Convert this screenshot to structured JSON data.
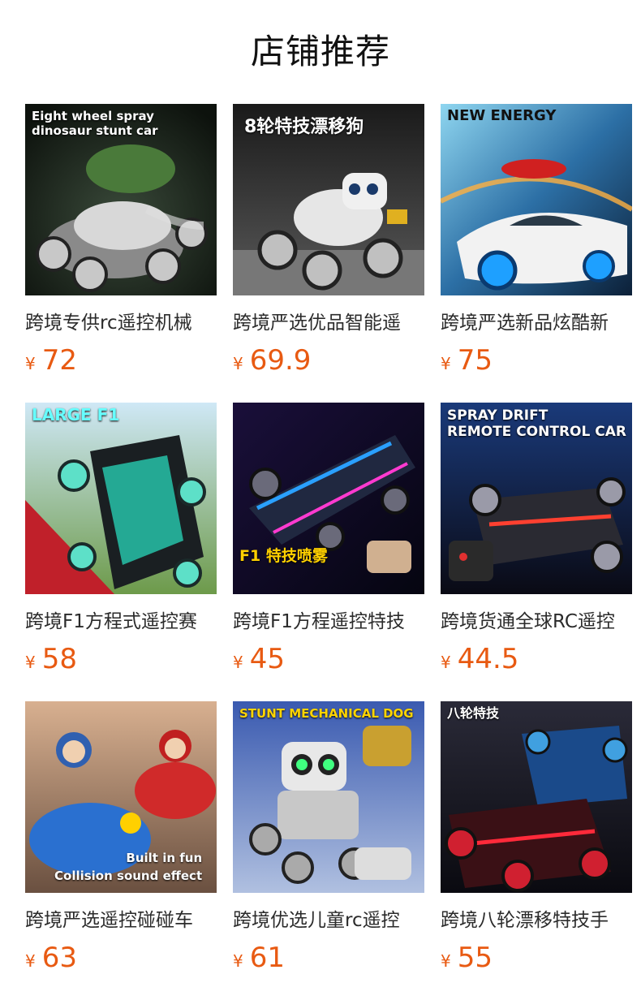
{
  "header": {
    "title": "店铺推荐"
  },
  "products": [
    {
      "title": "跨境专供rc遥控机械",
      "currency": "¥",
      "price": "72",
      "image_text": "Eight wheel spray\ndinosaur stunt car",
      "image_subject": "dinosaur-stunt-car"
    },
    {
      "title": "跨境严选优品智能遥",
      "currency": "¥",
      "price": "69.9",
      "image_text": "8轮特技漂移狗",
      "image_subject": "stunt-robot-dog"
    },
    {
      "title": "跨境严选新品炫酷新",
      "currency": "¥",
      "price": "75",
      "image_text": "NEW ENERGY",
      "image_subject": "concept-rc-car"
    },
    {
      "title": "跨境F1方程式遥控赛",
      "currency": "¥",
      "price": "58",
      "image_text": "LARGE F1",
      "image_subject": "f1-race-car-teal"
    },
    {
      "title": "跨境F1方程遥控特技",
      "currency": "¥",
      "price": "45",
      "image_text": "F1 特技喷雾",
      "image_subject": "f1-spray-stunt-car"
    },
    {
      "title": "跨境货通全球RC遥控",
      "currency": "¥",
      "price": "44.5",
      "image_text": "SPRAY DRIFT\nREMOTE CONTROL CAR",
      "image_subject": "spray-drift-car"
    },
    {
      "title": "跨境严选遥控碰碰车",
      "currency": "¥",
      "price": "63",
      "image_text": "Built in fun\nCollision sound effect",
      "image_subject": "bumper-cars"
    },
    {
      "title": "跨境优选儿童rc遥控",
      "currency": "¥",
      "price": "61",
      "image_text": "STUNT MECHANICAL DOG",
      "image_subject": "mechanical-dog"
    },
    {
      "title": "跨境八轮漂移特技手",
      "currency": "¥",
      "price": "55",
      "image_text": "八轮特技",
      "image_subject": "eight-wheel-drift-car"
    }
  ],
  "colors": {
    "price": "#e85a12",
    "title_text": "#111111"
  }
}
